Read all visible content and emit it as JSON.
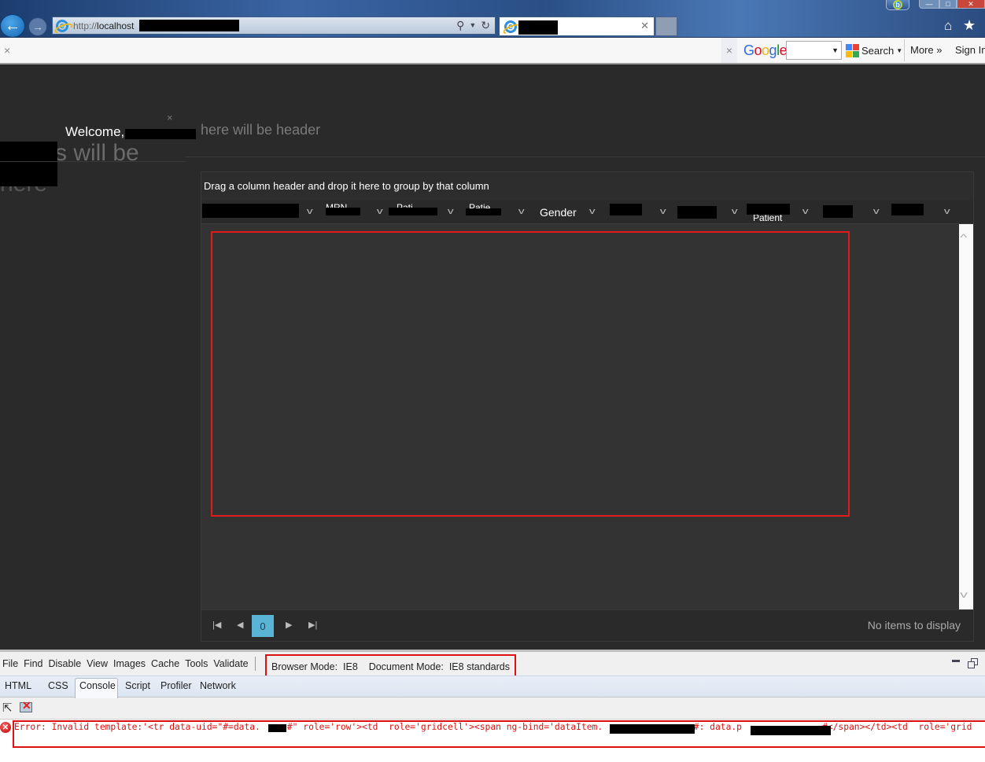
{
  "browser": {
    "url_scheme": "http://",
    "url_host": "localhost",
    "tab_title_redacted": true,
    "toolbar": {
      "close_label": "×",
      "google_logo": "Google",
      "search_label": "Search",
      "more_label": "More »",
      "signin_label": "Sign In"
    }
  },
  "page": {
    "welcome_text": "Welcome,",
    "header_placeholder": "here will be header",
    "side_text_1": "s will be",
    "side_text_2": "here",
    "close_label": "×"
  },
  "grid": {
    "grouping_hint": "Drag a column header and drop it here to group by that column",
    "columns": [
      {
        "label": "",
        "redacted": true
      },
      {
        "label": "MRN",
        "redacted": true
      },
      {
        "label": "Pati",
        "redacted": true
      },
      {
        "label": "Patie",
        "redacted": true
      },
      {
        "label": "Gender",
        "redacted": false
      },
      {
        "label": "",
        "redacted": true
      },
      {
        "label": "",
        "redacted": true
      },
      {
        "label": "Patient",
        "redacted": true
      },
      {
        "label": "",
        "redacted": true
      },
      {
        "label": "",
        "redacted": true
      }
    ],
    "pager": {
      "current_page": "0",
      "info": "No items to display"
    }
  },
  "devtools": {
    "menu": [
      "File",
      "Find",
      "Disable",
      "View",
      "Images",
      "Cache",
      "Tools",
      "Validate"
    ],
    "browser_mode_label": "Browser Mode:",
    "browser_mode_value": "IE8",
    "document_mode_label": "Document Mode:",
    "document_mode_value": "IE8 standards",
    "tabs": [
      "HTML",
      "CSS",
      "Console",
      "Script",
      "Profiler",
      "Network"
    ],
    "active_tab": "Console",
    "console_error": "Error: Invalid template:'<tr data-uid=\"#=data.     #\" role='row'><td  role='gridcell'><span ng-bind='dataItem.                >#: data.p               #</span></td><td  role='grid"
  },
  "colors": {
    "highlight_red": "#e21a1a",
    "pager_active": "#5ab4d6",
    "error_red": "#dd1111"
  }
}
